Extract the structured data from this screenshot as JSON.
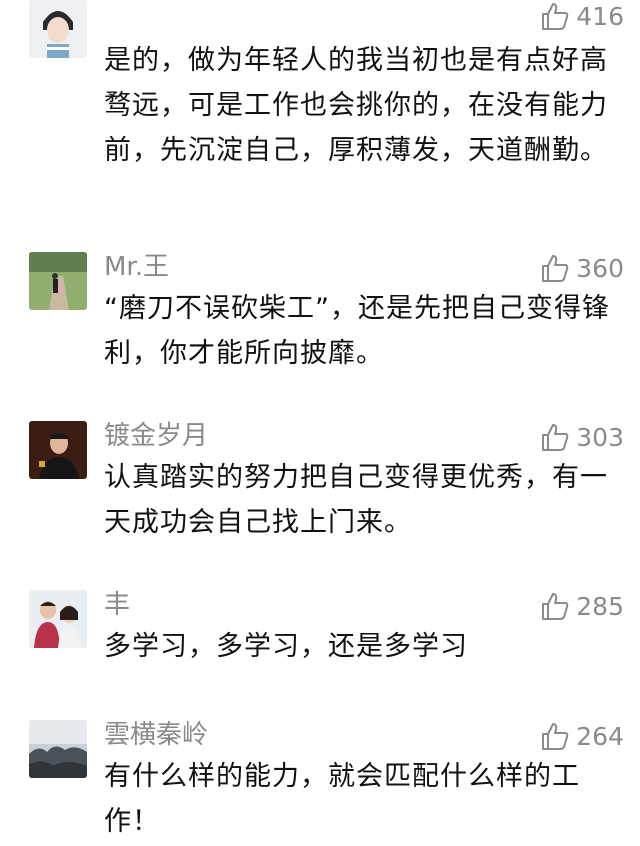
{
  "comments": [
    {
      "username": "",
      "likes": "416",
      "text": "是的，做为年轻人的我当初也是有点好高骛远，可是工作也会挑你的，在没有能力前，先沉淀自己，厚积薄发，天道酬勤。"
    },
    {
      "username": "Mr.王",
      "likes": "360",
      "text": "“磨刀不误砍柴工”，还是先把自己变得锋利，你才能所向披靡。"
    },
    {
      "username": "镀金岁月",
      "likes": "303",
      "text": "认真踏实的努力把自己变得更优秀，有一天成功会自己找上门来。"
    },
    {
      "username": "丰",
      "likes": "285",
      "text": "多学习，多学习，还是多学习"
    },
    {
      "username": "雲横秦岭",
      "likes": "264",
      "text": "有什么样的能力，就会匹配什么样的工作！"
    }
  ]
}
